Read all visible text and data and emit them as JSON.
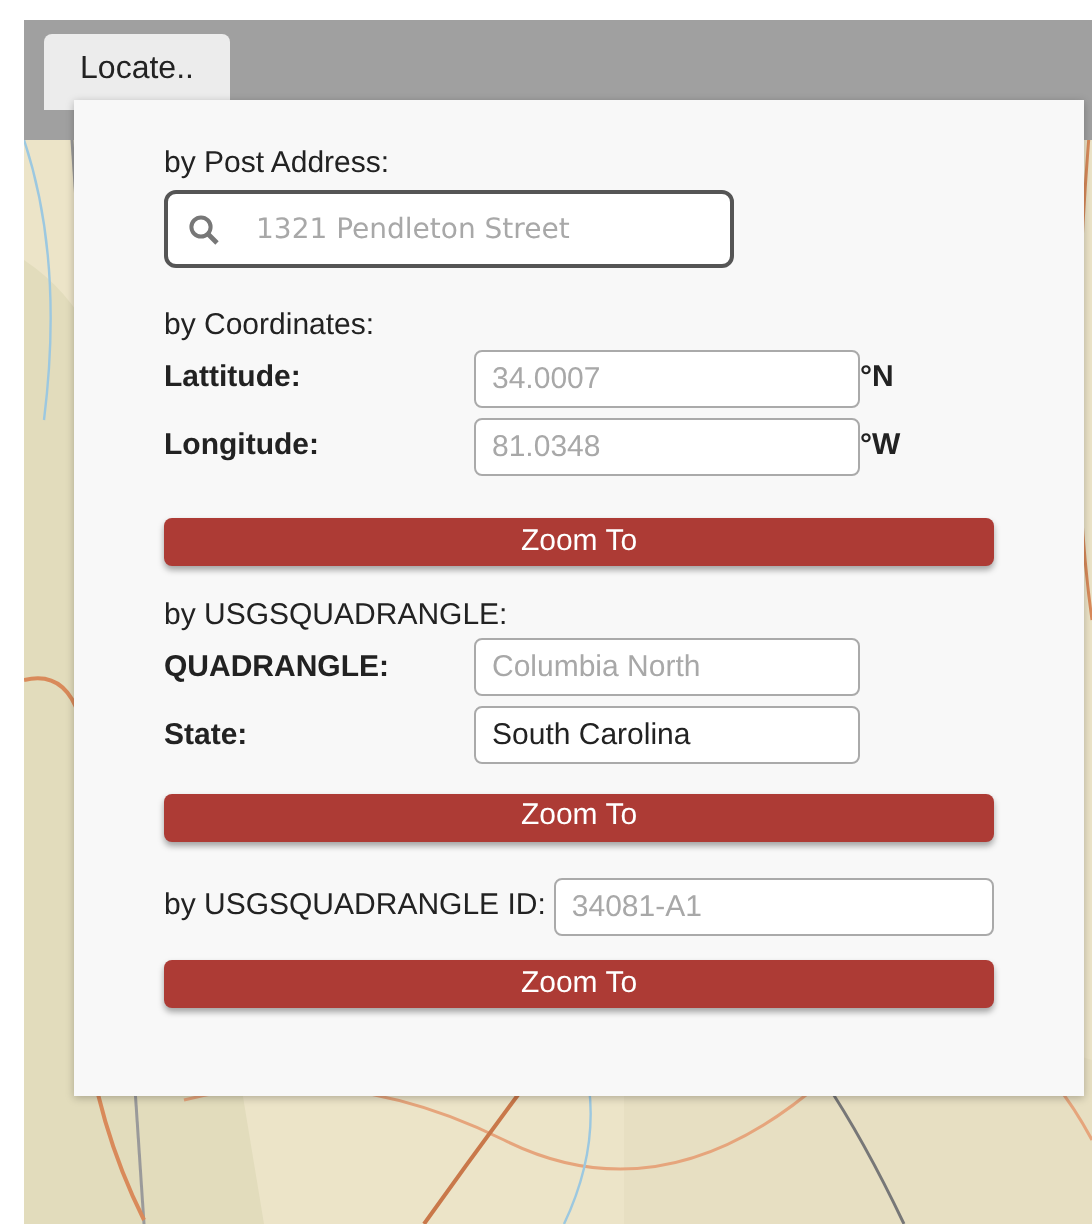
{
  "tab": {
    "label": "Locate.."
  },
  "address": {
    "heading": "by Post Address:",
    "placeholder": "1321 Pendleton Street"
  },
  "coordinates": {
    "heading": "by Coordinates:",
    "rows": [
      {
        "label": "Lattitude:",
        "placeholder": "34.0007",
        "unit": "°N"
      },
      {
        "label": "Longitude:",
        "placeholder": "81.0348",
        "unit": "°W"
      }
    ],
    "button": "Zoom To"
  },
  "quadrangle": {
    "heading": "by USGSQUADRANGLE:",
    "rows": [
      {
        "label": "QUADRANGLE:",
        "placeholder": "Columbia North"
      },
      {
        "label": "State:",
        "value": "South Carolina"
      }
    ],
    "button": "Zoom To"
  },
  "quadrangle_id": {
    "label": "by USGSQUADRANGLE ID:",
    "placeholder": "34081-A1",
    "button": "Zoom To"
  }
}
